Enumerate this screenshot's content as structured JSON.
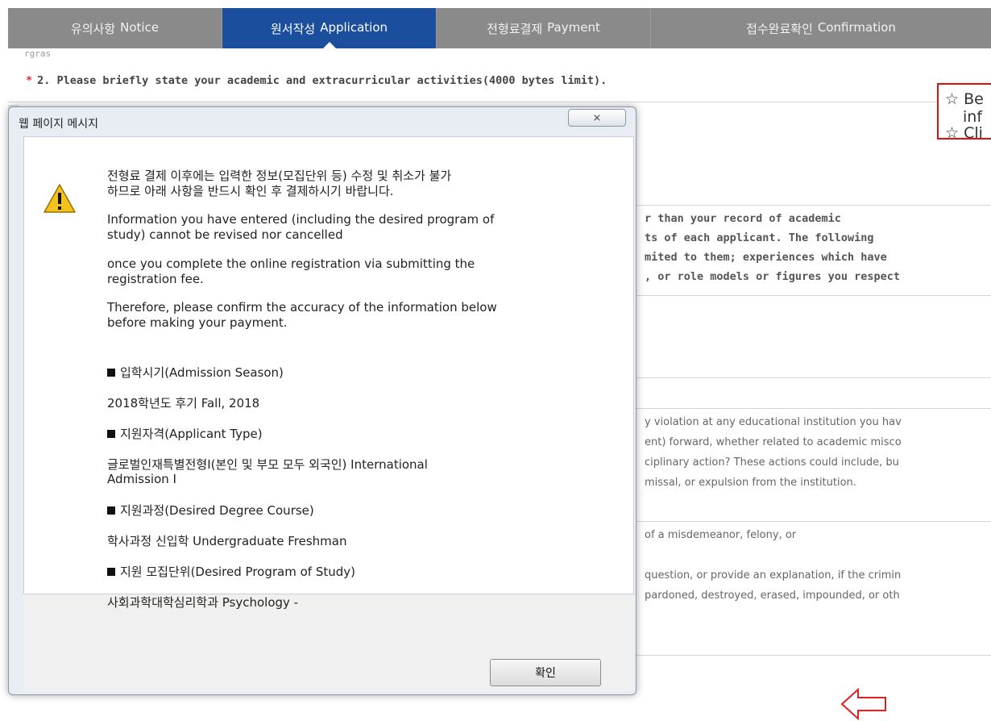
{
  "tabs": [
    {
      "ko": "유의사항",
      "en": "Notice",
      "active": false
    },
    {
      "ko": "원서작성",
      "en": "Application",
      "active": true
    },
    {
      "ko": "전형료결제",
      "en": "Payment",
      "active": false
    },
    {
      "ko": "접수완료확인",
      "en": "Confirmation",
      "active": false
    }
  ],
  "background": {
    "cut_line": "rgras",
    "question_required_mark": "*",
    "question_text": "2. Please briefly state your academic and extracurricular activities(4000 bytes limit).",
    "essay_prompt_lines": [
      "r than your record of academic",
      "ts of each applicant. The following",
      "mited to them; experiences which have",
      ", or role models or figures you respect"
    ],
    "discipline_lines": [
      "y violation at any educational institution you hav",
      "ent) forward, whether related to academic misco",
      "ciplinary action? These actions could include, bu",
      "missal, or expulsion from the institution."
    ],
    "criminal_line": "of a misdemeanor, felony, or",
    "criminal_explain_lines": [
      "question, or provide an explanation, if the crimin",
      "pardoned, destroyed, erased, impounded, or oth"
    ],
    "notice_box": {
      "line1": "☆ Be",
      "line2": "inf",
      "line3": "☆ Cli",
      "border_color": "#e01010"
    }
  },
  "dialog": {
    "title": "웹 페이지 메시지",
    "close_label": "⨯",
    "warning_icon": "warning-triangle-icon",
    "warning_ko_line1": "전형료 결제 이후에는 입력한 정보(모집단위 등) 수정 및 취소가 불가",
    "warning_ko_line2": "하므로 아래 사항을 반드시 확인 후 결제하시기 바랍니다.",
    "info_en_line1": "Information you have entered (including the desired program of",
    "info_en_line2": "study) cannot be revised nor cancelled",
    "once_line1": "once you complete the online registration via submitting the",
    "once_line2": "registration fee.",
    "confirm_line1": "Therefore, please confirm the accuracy of the information below",
    "confirm_line2": "before making your payment.",
    "items": [
      {
        "label": "입학시기(Admission Season)",
        "value": "2018학년도 후기  Fall, 2018",
        "value2": ""
      },
      {
        "label": "지원자격(Applicant Type)",
        "value": "글로벌인재특별전형I(본인 및 부모 모두 외국인) International",
        "value2": "Admission I"
      },
      {
        "label": "지원과정(Desired Degree Course)",
        "value": "학사과정 신입학 Undergraduate Freshman",
        "value2": ""
      },
      {
        "label": "지원 모집단위(Desired Program of Study)",
        "value": "사회과학대학심리학과 Psychology -",
        "value2": ""
      }
    ],
    "ok_label": "확인"
  },
  "colors": {
    "tab_bg": "#8a8a8a",
    "tab_active": "#1b4e9c",
    "required": "#e03030"
  }
}
